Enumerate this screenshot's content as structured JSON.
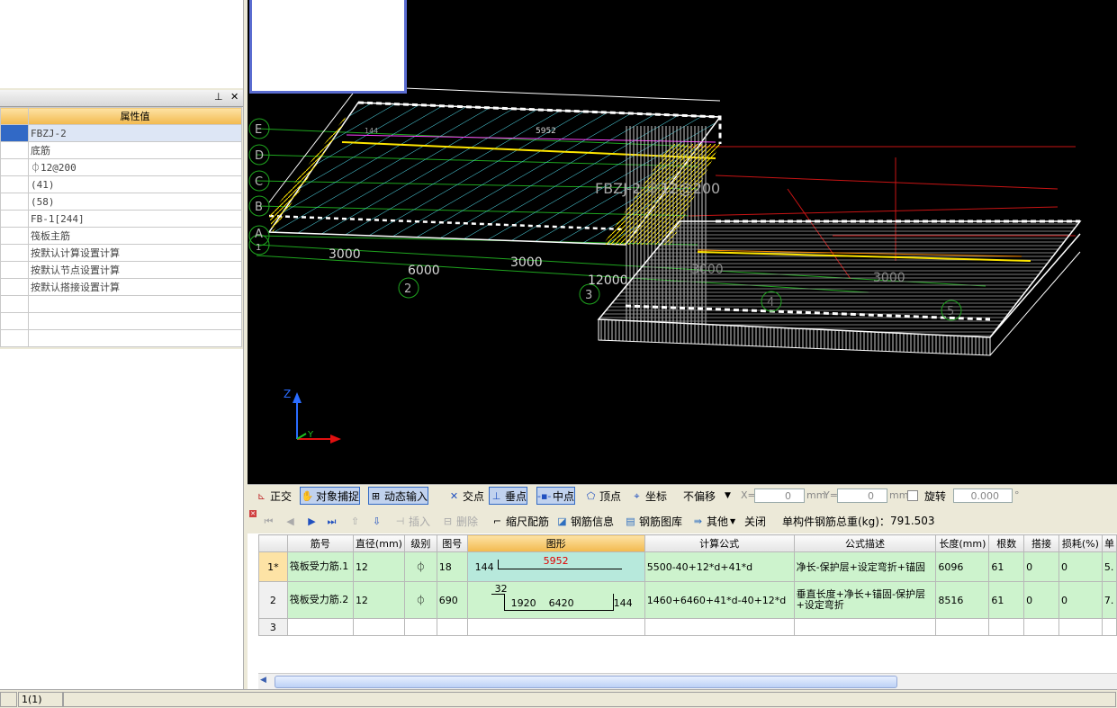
{
  "left_panel": {
    "pin_icon": "pin-icon",
    "close_icon": "close-icon",
    "table": {
      "value_header": "属性值",
      "rows": [
        "FBZJ-2",
        "底筋",
        "⏀12@200",
        "(41)",
        "(58)",
        "FB-1[244]",
        "筏板主筋",
        "按默认计算设置计算",
        "按默认节点设置计算",
        "按默认搭接设置计算",
        "",
        "",
        ""
      ]
    }
  },
  "viewport": {
    "axis_labels": [
      "E",
      "D",
      "C",
      "B",
      "A",
      "1"
    ],
    "top_dim": "5952",
    "small_dim": "144",
    "dims": [
      "3000",
      "6000",
      "3000",
      "12000",
      "3000",
      "3000"
    ],
    "grid_numbers": [
      "2",
      "3",
      "4",
      "5"
    ],
    "annotation": "FBZJ-2 ⏀12@200",
    "axis_z": "Z",
    "axis_y": "Y"
  },
  "snap_toolbar": {
    "orthogonal": "正交",
    "object_snap": "对象捕捉",
    "dynamic_input": "动态输入",
    "intersection": "交点",
    "perpendicular": "垂点",
    "midpoint": "中点",
    "vertex": "顶点",
    "coordinate": "坐标",
    "offset_mode": "不偏移",
    "x_label": "X=",
    "x_value": "0",
    "y_label": "Y=",
    "y_value": "0",
    "unit": "mm",
    "rotate_label": "旋转",
    "rotate_value": "0.000",
    "degree": "°"
  },
  "rebar_toolbar": {
    "insert": "插入",
    "delete": "删除",
    "scale_rebar": "缩尺配筋",
    "rebar_info": "钢筋信息",
    "rebar_library": "钢筋图库",
    "other": "其他",
    "close": "关闭",
    "total_weight_label": "单构件钢筋总重(kg)：",
    "total_weight": "791.503"
  },
  "rebar_table": {
    "headers": {
      "bar_no": "筋号",
      "diameter": "直径(mm)",
      "grade": "级别",
      "shape_no": "图号",
      "shape": "图形",
      "formula": "计算公式",
      "desc": "公式描述",
      "length": "长度(mm)",
      "count": "根数",
      "lap": "搭接",
      "loss": "损耗(%)",
      "unit": "单"
    },
    "rows": [
      {
        "row": "1*",
        "bar_no": "筏板受力筋.1",
        "diameter": "12",
        "grade": "⏀",
        "shape_no": "18",
        "shape_left": "144",
        "shape_mid": "5952",
        "formula": "5500-40+12*d+41*d",
        "desc": "净长-保护层+设定弯折+锚固",
        "length": "6096",
        "count": "61",
        "lap": "0",
        "loss": "0",
        "unit": "5."
      },
      {
        "row": "2",
        "bar_no": "筏板受力筋.2",
        "diameter": "12",
        "grade": "⏀",
        "shape_no": "690",
        "shape_top": "32",
        "shape_a": "1920",
        "shape_b": "6420",
        "shape_right": "144",
        "formula": "1460+6460+41*d-40+12*d",
        "desc": "垂直长度+净长+锚固-保护层+设定弯折",
        "length": "8516",
        "count": "61",
        "lap": "0",
        "loss": "0",
        "unit": "7."
      },
      {
        "row": "3"
      }
    ]
  },
  "status": {
    "cell2": "1(1)"
  }
}
